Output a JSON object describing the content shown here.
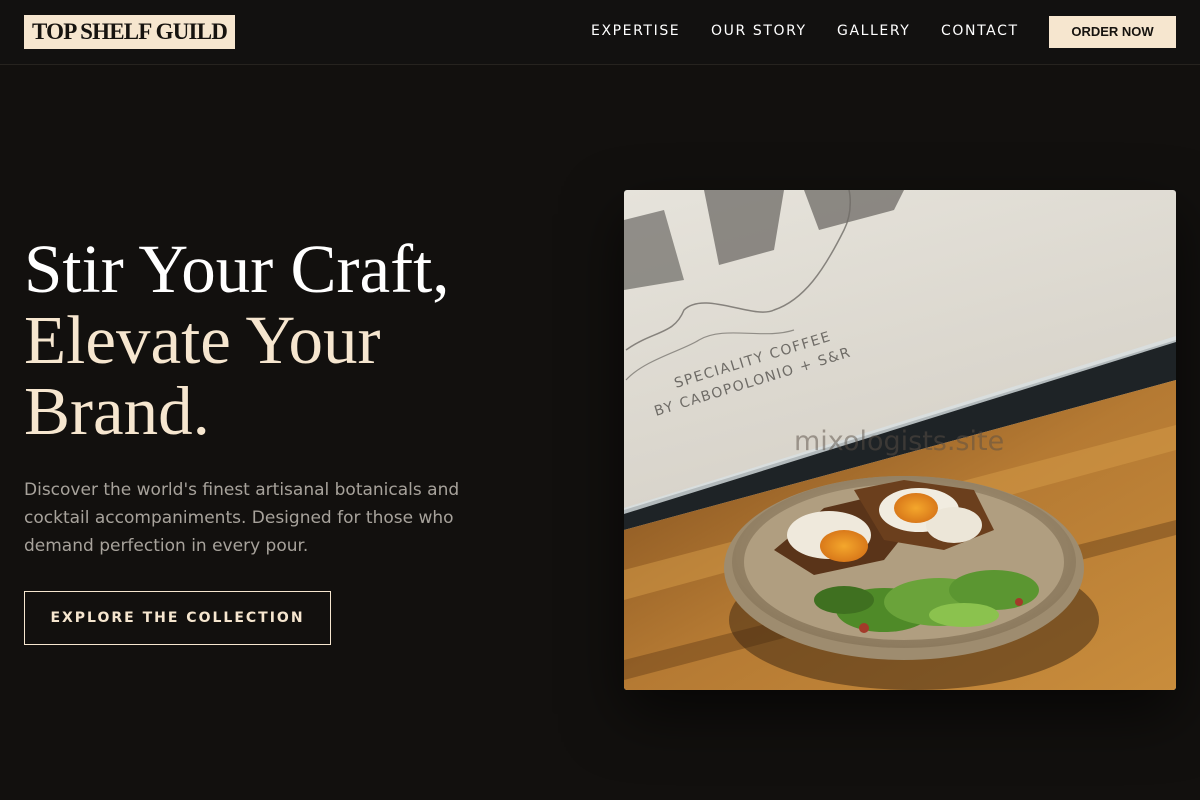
{
  "header": {
    "logo": "TOP SHELF GUILD",
    "nav": [
      "EXPERTISE",
      "OUR STORY",
      "GALLERY",
      "CONTACT"
    ],
    "order_button": "ORDER NOW"
  },
  "hero": {
    "headline_line1": "Stir Your Craft,",
    "headline_line2": "Elevate Your",
    "headline_line3": "Brand.",
    "description": "Discover the world's finest artisanal botanicals and cocktail accompaniments. Designed for those who demand perfection in every pour.",
    "cta": "EXPLORE THE COLLECTION"
  },
  "image": {
    "window_text_line1": "SPECIALITY COFFEE",
    "window_text_line2": "BY CABOPOLONIO + S&R",
    "watermark": "mixologists.site"
  },
  "colors": {
    "background": "#12100e",
    "accent_cream": "#f6e6cf",
    "body_text": "#a7a29b"
  }
}
